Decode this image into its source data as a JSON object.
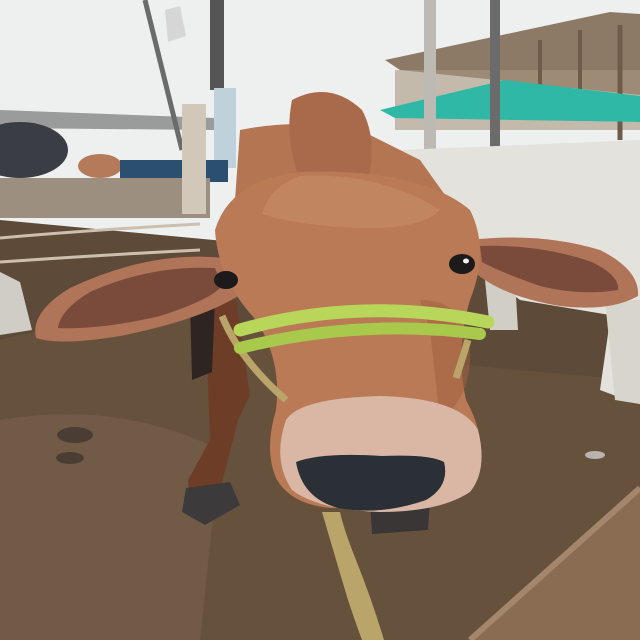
{
  "scene": {
    "subject": "calf",
    "colors": {
      "sky": "#eef0f0",
      "ground": "#5e4a38",
      "ground_light": "#7a6450",
      "calf_coat": "#b97a55",
      "calf_coat_dark": "#9a5f3e",
      "calf_ear_inner": "#7a4a3a",
      "muzzle_skin": "#d9b7a4",
      "nose": "#2b2f36",
      "halter": "#b8d65a",
      "rope": "#b9a46a",
      "tarp": "#2fb8a6",
      "shed_roof": "#8d7a66",
      "wood": "#8a6c52",
      "white_cow": "#e4e2dc"
    }
  }
}
